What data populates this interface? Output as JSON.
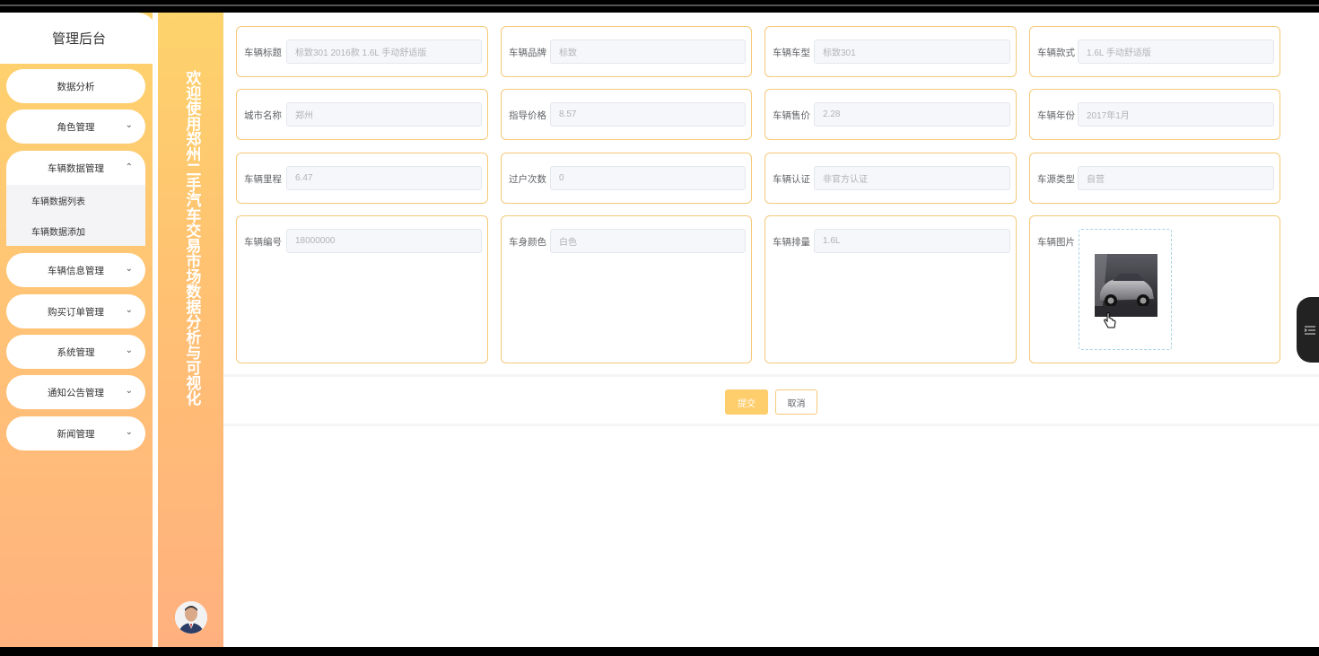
{
  "sidebar": {
    "title": "管理后台",
    "items": [
      {
        "label": "数据分析",
        "has_chevron": false
      },
      {
        "label": "角色管理",
        "has_chevron": true,
        "chevron": "⌄"
      },
      {
        "label": "车辆数据管理",
        "has_chevron": true,
        "chevron": "⌃",
        "open": true,
        "children": [
          {
            "label": "车辆数据列表"
          },
          {
            "label": "车辆数据添加"
          }
        ]
      },
      {
        "label": "车辆信息管理",
        "has_chevron": true,
        "chevron": "⌄"
      },
      {
        "label": "购买订单管理",
        "has_chevron": true,
        "chevron": "⌄"
      },
      {
        "label": "系统管理",
        "has_chevron": true,
        "chevron": "⌄"
      },
      {
        "label": "通知公告管理",
        "has_chevron": true,
        "chevron": "⌄"
      },
      {
        "label": "新闻管理",
        "has_chevron": true,
        "chevron": "⌄"
      }
    ]
  },
  "banner": {
    "text": "欢迎使用郑州二手汽车交易市场数据分析与可视化"
  },
  "form": {
    "rows": [
      [
        {
          "label": "车辆标题",
          "value": "标致301 2016款 1.6L 手动舒适版"
        },
        {
          "label": "车辆品牌",
          "value": "标致"
        },
        {
          "label": "车辆车型",
          "value": "标致301"
        },
        {
          "label": "车辆款式",
          "value": "1.6L 手动舒适版"
        }
      ],
      [
        {
          "label": "城市名称",
          "value": "郑州"
        },
        {
          "label": "指导价格",
          "value": "8.57"
        },
        {
          "label": "车辆售价",
          "value": "2.28"
        },
        {
          "label": "车辆年份",
          "value": "2017年1月"
        }
      ],
      [
        {
          "label": "车辆里程",
          "value": "6.47"
        },
        {
          "label": "过户次数",
          "value": "0"
        },
        {
          "label": "车辆认证",
          "value": "非官方认证"
        },
        {
          "label": "车源类型",
          "value": "自营"
        }
      ],
      [
        {
          "label": "车辆编号",
          "value": "18000000"
        },
        {
          "label": "车身颜色",
          "value": "白色"
        },
        {
          "label": "车辆排量",
          "value": "1.6L"
        },
        {
          "label": "车辆图片",
          "value": ""
        }
      ]
    ]
  },
  "actions": {
    "submit": "提交",
    "cancel": "取消"
  },
  "colors": {
    "accent": "#fecd6c",
    "card_border": "#f5c978",
    "sidebar_top": "#fdd36c",
    "sidebar_bottom": "#ffb27e"
  }
}
